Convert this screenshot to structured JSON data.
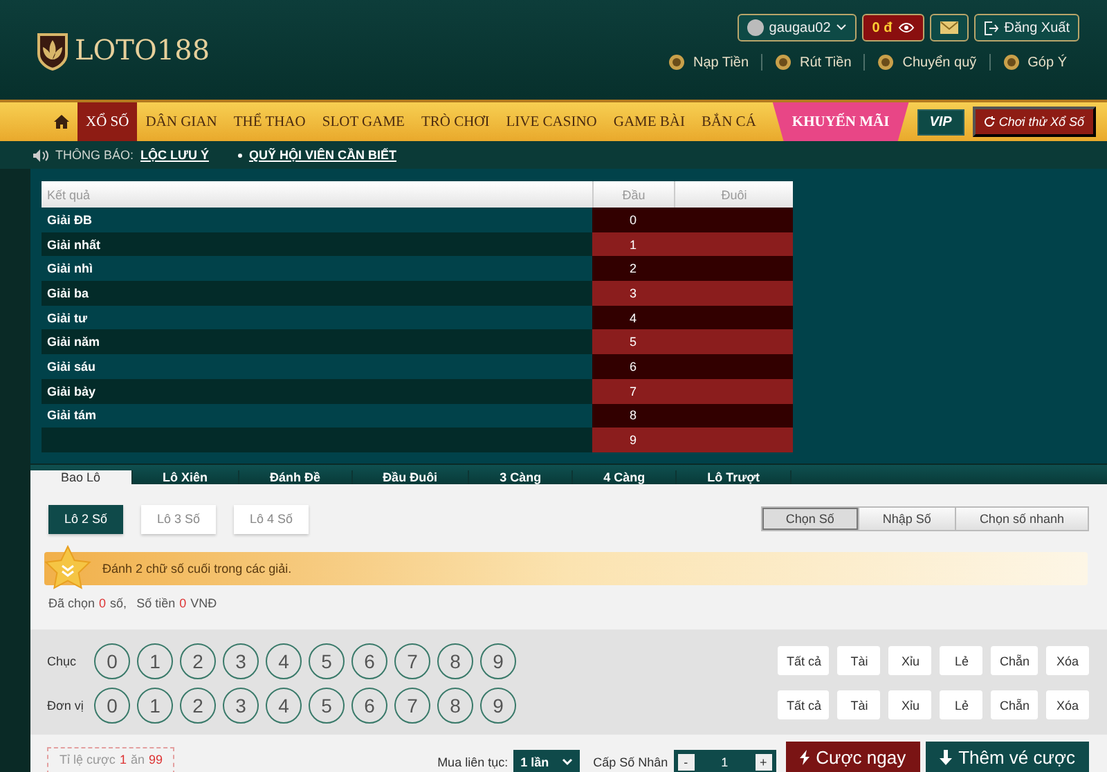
{
  "header": {
    "logo": "LOTO188",
    "username": "gaugau02",
    "balance": "0 đ",
    "logout": "Đăng Xuất",
    "links": [
      {
        "label": "Nạp Tiền"
      },
      {
        "label": "Rút Tiền"
      },
      {
        "label": "Chuyển quỹ"
      },
      {
        "label": "Góp Ý"
      }
    ]
  },
  "nav": {
    "items": [
      {
        "label": "XỔ SỐ",
        "selected": true
      },
      {
        "label": "DÂN GIAN",
        "selected": false
      },
      {
        "label": "THỂ THAO",
        "selected": false
      },
      {
        "label": "SLOT GAME",
        "selected": false
      },
      {
        "label": "TRÒ CHƠI",
        "selected": false
      },
      {
        "label": "LIVE CASINO",
        "selected": false
      },
      {
        "label": "GAME BÀI",
        "selected": false
      },
      {
        "label": "BẮN CÁ",
        "selected": false
      }
    ],
    "promo": "KHUYẾN MÃI",
    "vip": "VIP",
    "trial": "Chơi thử Xổ Số"
  },
  "notice": {
    "label": "THÔNG BÁO:",
    "links": [
      "LỘC LƯU Ý",
      "QUỸ HỘI VIÊN CẦN BIẾT"
    ]
  },
  "results": {
    "columns": [
      "Kết quả",
      "Đầu",
      "Đuôi"
    ],
    "rows": [
      {
        "prize": "Giải ĐB",
        "head": "0"
      },
      {
        "prize": "Giải nhất",
        "head": "1"
      },
      {
        "prize": "Giải nhì",
        "head": "2"
      },
      {
        "prize": "Giải ba",
        "head": "3"
      },
      {
        "prize": "Giải tư",
        "head": "4"
      },
      {
        "prize": "Giải năm",
        "head": "5"
      },
      {
        "prize": "Giải sáu",
        "head": "6"
      },
      {
        "prize": "Giải bảy",
        "head": "7"
      },
      {
        "prize": "Giải tám",
        "head": "8"
      },
      {
        "head": "9"
      }
    ]
  },
  "tabs": [
    {
      "label": "Bao Lô",
      "selected": true
    },
    {
      "label": "Lô Xiên",
      "selected": false
    },
    {
      "label": "Đánh Đề",
      "selected": false
    },
    {
      "label": "Đầu Đuôi",
      "selected": false
    },
    {
      "label": "3 Càng",
      "selected": false
    },
    {
      "label": "4 Càng",
      "selected": false
    },
    {
      "label": "Lô Trượt",
      "selected": false
    }
  ],
  "bet_types": [
    {
      "label": "Lô 2 Số",
      "selected": true
    },
    {
      "label": "Lô 3 Số",
      "selected": false
    },
    {
      "label": "Lô 4 Số",
      "selected": false
    }
  ],
  "modes": [
    {
      "label": "Chọn Số",
      "selected": true
    },
    {
      "label": "Nhập Số",
      "selected": false
    },
    {
      "label": "Chọn số nhanh",
      "selected": false
    }
  ],
  "hint": "Đánh 2 chữ số cuối trong các giải.",
  "summary": {
    "chosen_label": "Đã chọn",
    "chosen_count": "0",
    "chosen_unit": "số,",
    "amount_label": "Số tiền",
    "amount": "0",
    "currency": "VNĐ"
  },
  "digit_rows": [
    {
      "label": "Chục",
      "digits": [
        {
          "value": "0",
          "selected": false
        },
        {
          "value": "1",
          "selected": false
        },
        {
          "value": "2",
          "selected": false
        },
        {
          "value": "3",
          "selected": false
        },
        {
          "value": "4",
          "selected": false
        },
        {
          "value": "5",
          "selected": false
        },
        {
          "value": "6",
          "selected": false
        },
        {
          "value": "7",
          "selected": false
        },
        {
          "value": "8",
          "selected": false
        },
        {
          "value": "9",
          "selected": false
        }
      ],
      "quick": [
        "Tất cả",
        "Tài",
        "Xỉu",
        "Lẻ",
        "Chẵn",
        "Xóa"
      ]
    },
    {
      "label": "Đơn vị",
      "digits": [
        {
          "value": "0",
          "selected": false
        },
        {
          "value": "1",
          "selected": false
        },
        {
          "value": "2",
          "selected": false
        },
        {
          "value": "3",
          "selected": false
        },
        {
          "value": "4",
          "selected": false
        },
        {
          "value": "5",
          "selected": false
        },
        {
          "value": "6",
          "selected": false
        },
        {
          "value": "7",
          "selected": false
        },
        {
          "value": "8",
          "selected": false
        },
        {
          "value": "9",
          "selected": false
        }
      ],
      "quick": [
        "Tất cả",
        "Tài",
        "Xỉu",
        "Lẻ",
        "Chẵn",
        "Xóa"
      ]
    }
  ],
  "footer": {
    "odds_label": "Tỉ lệ cược",
    "odds_stake": "1",
    "odds_word": "ăn",
    "odds_payout": "99",
    "repeat_label": "Mua liên tục:",
    "repeat_value": "1 lần",
    "multiplier_label": "Cấp Số Nhân",
    "minus": "-",
    "multiplier": "1",
    "plus": "+",
    "bet_now": "Cược ngay",
    "add_ticket": "Thêm vé cược"
  }
}
